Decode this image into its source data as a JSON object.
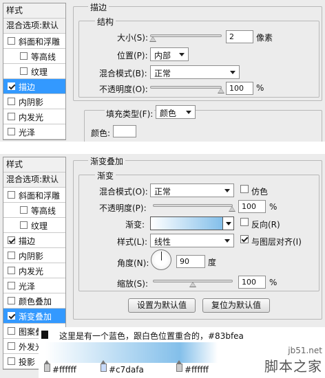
{
  "panel1": {
    "sidebar": {
      "header": "样式",
      "items": [
        {
          "label": "混合选项:默认",
          "type": "header"
        },
        {
          "label": "斜面和浮雕",
          "checked": false
        },
        {
          "label": "等高线",
          "checked": false,
          "indent": true
        },
        {
          "label": "纹理",
          "checked": false,
          "indent": true
        },
        {
          "label": "描边",
          "checked": true,
          "selected": true
        },
        {
          "label": "内阴影",
          "checked": false
        },
        {
          "label": "内发光",
          "checked": false
        },
        {
          "label": "光泽",
          "checked": false
        }
      ]
    },
    "title": "描边",
    "structure": {
      "title": "结构",
      "size_label": "大小(S):",
      "size_value": "2",
      "size_unit": "像素",
      "size_level": 0.03,
      "position_label": "位置(P):",
      "position_value": "内部",
      "blend_label": "混合模式(B):",
      "blend_value": "正常",
      "opacity_label": "不透明度(O):",
      "opacity_value": "100",
      "opacity_unit": "%",
      "opacity_level": 1.0
    },
    "fill": {
      "type_label": "填充类型(F):",
      "type_value": "颜色",
      "color_label": "颜色:",
      "color": "#ffffff"
    }
  },
  "panel2": {
    "sidebar": {
      "header": "样式",
      "items": [
        {
          "label": "混合选项:默认",
          "type": "header"
        },
        {
          "label": "斜面和浮雕",
          "checked": false
        },
        {
          "label": "等高线",
          "checked": false,
          "indent": true
        },
        {
          "label": "纹理",
          "checked": false,
          "indent": true
        },
        {
          "label": "描边",
          "checked": true
        },
        {
          "label": "内阴影",
          "checked": false
        },
        {
          "label": "内发光",
          "checked": false
        },
        {
          "label": "光泽",
          "checked": false
        },
        {
          "label": "颜色叠加",
          "checked": false
        },
        {
          "label": "渐变叠加",
          "checked": true,
          "selected": true
        },
        {
          "label": "图案叠",
          "checked": false
        },
        {
          "label": "外发光",
          "checked": false
        },
        {
          "label": "投影",
          "checked": false
        }
      ]
    },
    "title": "渐变叠加",
    "gradient": {
      "title": "渐变",
      "blend_label": "混合模式(O):",
      "blend_value": "正常",
      "dither_label": "仿色",
      "dither": false,
      "opacity_label": "不透明度(P):",
      "opacity_value": "100",
      "opacity_unit": "%",
      "opacity_level": 1.0,
      "gradient_label": "渐变:",
      "reverse_label": "反向(R)",
      "reverse": false,
      "style_label": "样式(L):",
      "style_value": "线性",
      "align_label": "与图层对齐(I)",
      "align": true,
      "angle_label": "角度(N):",
      "angle_value": "90",
      "angle_unit": "度",
      "scale_label": "缩放(S):",
      "scale_value": "100",
      "scale_unit": "%",
      "scale_level": 0.5
    },
    "buttons": {
      "set_default": "设置为默认值",
      "reset_default": "复位为默认值"
    }
  },
  "overlay": {
    "note": "这里是有一个蓝色，跟白色位置重合的，#83bfea",
    "stops": [
      {
        "label": "#ffffff"
      },
      {
        "label": "#c7dafa"
      },
      {
        "label": "#ffffff"
      }
    ],
    "gradient_colors": [
      "#ffffff",
      "#83bfea",
      "#ffffff"
    ]
  },
  "watermark": {
    "line1": "jb51.net",
    "line2": "脚本之家"
  }
}
